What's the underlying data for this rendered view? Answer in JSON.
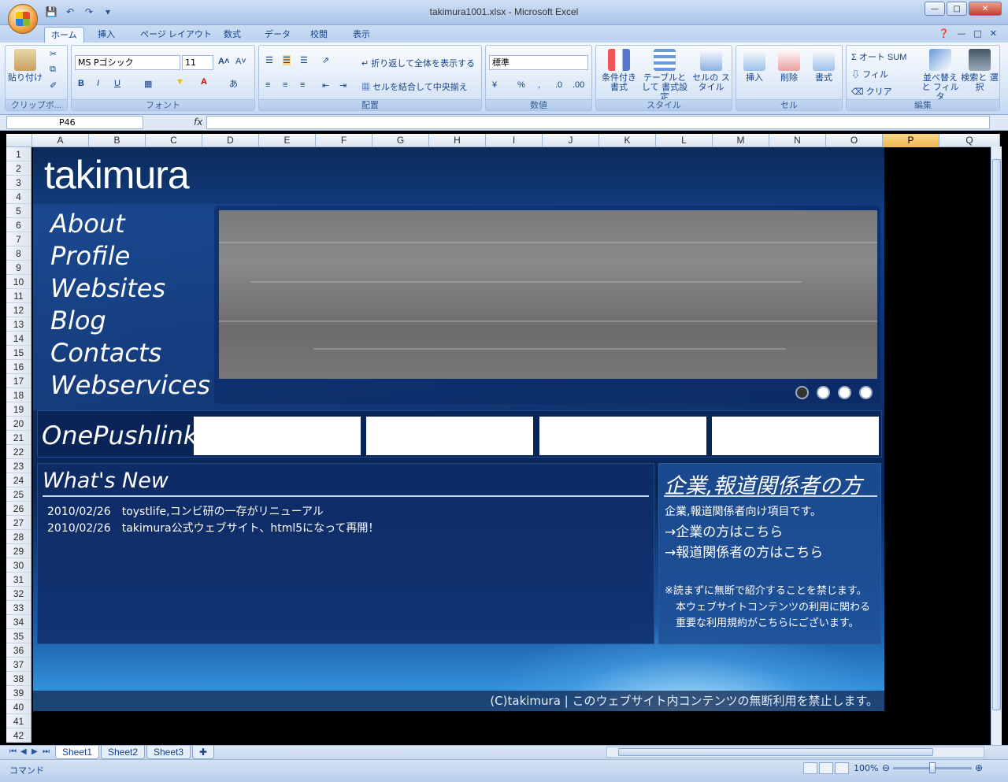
{
  "window": {
    "title": "takimura1001.xlsx - Microsoft Excel"
  },
  "ribbon_tabs": [
    "ホーム",
    "挿入",
    "ページ レイアウト",
    "数式",
    "データ",
    "校閲",
    "表示"
  ],
  "ribbon": {
    "clipboard": {
      "paste": "貼り付け",
      "group": "クリップボ..."
    },
    "font": {
      "name": "MS Pゴシック",
      "size": "11",
      "group": "フォント"
    },
    "alignment": {
      "wrap": "折り返して全体を表示する",
      "merge": "セルを結合して中央揃え",
      "group": "配置"
    },
    "number": {
      "format": "標準",
      "group": "数値"
    },
    "styles": {
      "cond": "条件付き 書式",
      "table": "テーブルとして 書式設定",
      "cell": "セルの スタイル",
      "group": "スタイル"
    },
    "cells": {
      "insert": "挿入",
      "delete": "削除",
      "format": "書式",
      "group": "セル"
    },
    "editing": {
      "autosum": "オート SUM",
      "fill": "フィル",
      "clear": "クリア",
      "sort": "並べ替えと フィルタ",
      "find": "検索と 選択",
      "group": "編集"
    }
  },
  "formula_bar": {
    "name_box": "P46",
    "fx": "fx",
    "content": ""
  },
  "columns": [
    "A",
    "B",
    "C",
    "D",
    "E",
    "F",
    "G",
    "H",
    "I",
    "J",
    "K",
    "L",
    "M",
    "N",
    "O",
    "P",
    "Q"
  ],
  "selected_column": "P",
  "rows": [
    "1",
    "2",
    "3",
    "4",
    "5",
    "6",
    "7",
    "8",
    "9",
    "10",
    "11",
    "12",
    "13",
    "14",
    "15",
    "16",
    "17",
    "18",
    "19",
    "20",
    "21",
    "22",
    "23",
    "24",
    "25",
    "26",
    "27",
    "28",
    "29",
    "30",
    "31",
    "32",
    "33",
    "34",
    "35",
    "36",
    "37",
    "38",
    "39",
    "40",
    "41",
    "42"
  ],
  "site": {
    "logo": "takimura",
    "nav": [
      "About",
      "Profile",
      "Websites",
      "Blog",
      "Contacts",
      "Webservices"
    ],
    "slider_dots": 4,
    "slider_active_dot": 0,
    "onepush_label": "OnePushlink",
    "news_title": "What's New",
    "news": [
      {
        "date": "2010/02/26",
        "text": "toystlife,コンビ研の一存がリニューアル"
      },
      {
        "date": "2010/02/26",
        "text": "takimura公式ウェブサイト、html5になって再開！"
      }
    ],
    "corp_title": "企業,報道関係者の方",
    "corp_lines": [
      "企業,報道関係者向け項目です。",
      "→企業の方はこちら",
      "→報道関係者の方はこちら"
    ],
    "corp_notes": [
      "※読まずに無断で紹介することを禁じます。",
      "本ウェブサイトコンテンツの利用に関わる",
      "重要な利用規約がこちらにございます。"
    ],
    "footer": "(C)takimura | このウェブサイト内コンテンツの無断利用を禁止します。"
  },
  "sheets": [
    "Sheet1",
    "Sheet2",
    "Sheet3"
  ],
  "active_sheet": "Sheet1",
  "status": {
    "mode": "コマンド",
    "zoom": "100%"
  }
}
